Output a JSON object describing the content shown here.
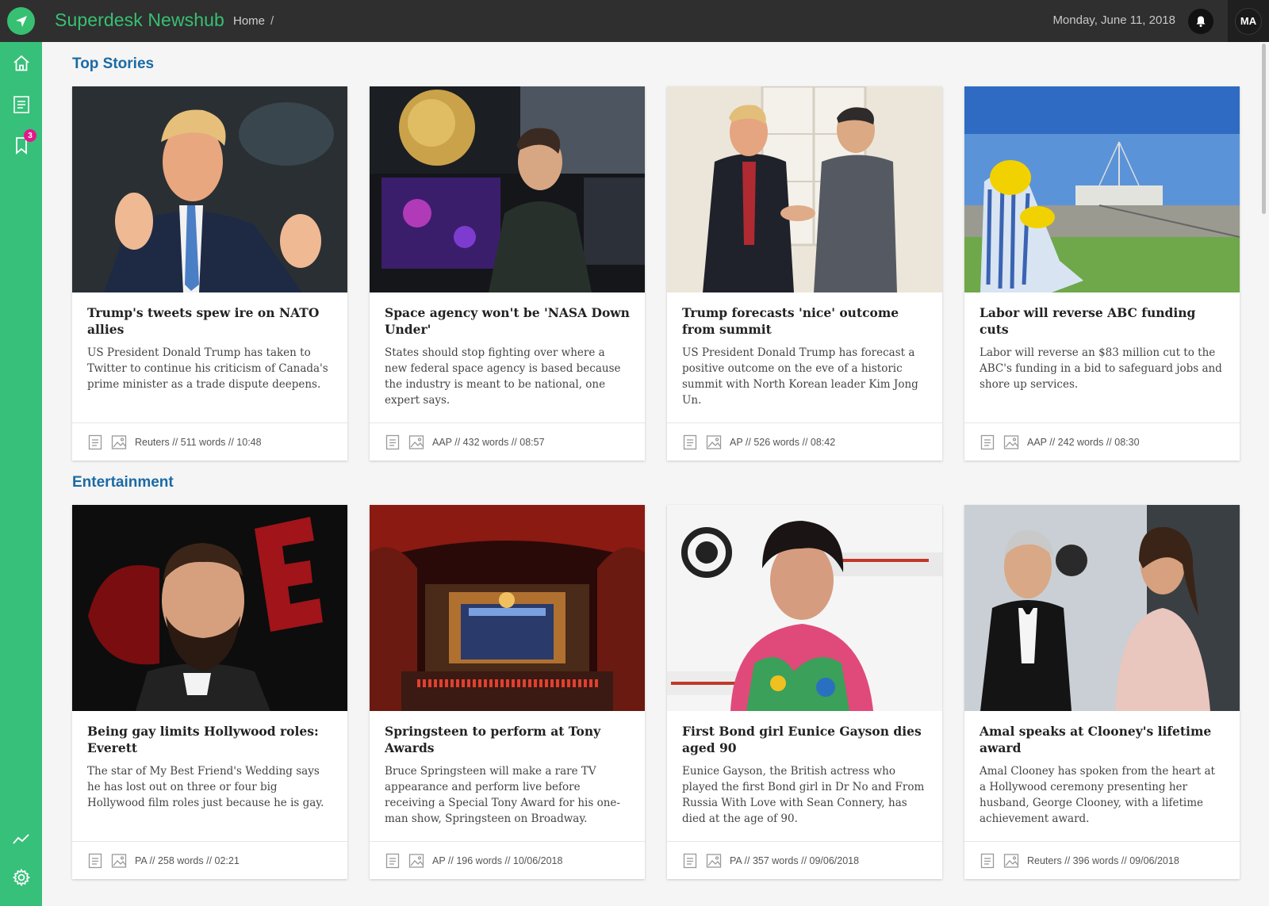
{
  "app": {
    "title": "Superdesk Newshub",
    "breadcrumb": "Home",
    "breadcrumb_sep": "/",
    "date": "Monday, June 11, 2018",
    "user_initials": "MA",
    "saved_count": "3"
  },
  "colors": {
    "brand": "#37c072",
    "sidebar": "#37c07a",
    "section_title": "#1b6aa5",
    "badge": "#e5178a"
  },
  "sections": [
    {
      "title": "Top Stories",
      "cards": [
        {
          "headline": "Trump's tweets spew ire on NATO allies",
          "summary": "US President Donald Trump has taken to Twitter to continue his criticism of Canada's prime minister as a trade dispute deepens.",
          "meta": "Reuters // 511 words // 10:48"
        },
        {
          "headline": "Space agency won't be 'NASA Down Under'",
          "summary": "States should stop fighting over where a new federal space agency is based because the industry is meant to be national, one expert says.",
          "meta": "AAP // 432 words // 08:57"
        },
        {
          "headline": "Trump forecasts 'nice' outcome from summit",
          "summary": "US President Donald Trump has forecast a positive outcome on the eve of a historic summit with North Korean leader Kim Jong Un.",
          "meta": "AP // 526 words // 08:42"
        },
        {
          "headline": "Labor will reverse ABC funding cuts",
          "summary": "Labor will reverse an $83 million cut to the ABC's funding in a bid to safeguard jobs and shore up services.",
          "meta": "AAP // 242 words // 08:30"
        }
      ]
    },
    {
      "title": "Entertainment",
      "cards": [
        {
          "headline": "Being gay limits Hollywood roles: Everett",
          "summary": "The star of My Best Friend's Wedding says he has lost out on three or four big Hollywood film roles just because he is gay.",
          "meta": "PA // 258 words // 02:21"
        },
        {
          "headline": "Springsteen to perform at Tony Awards",
          "summary": "Bruce Springsteen will make a rare TV appearance and perform live before receiving a Special Tony Award for his one-man show, Springsteen on Broadway.",
          "meta": "AP // 196 words // 10/06/2018"
        },
        {
          "headline": "First Bond girl Eunice Gayson dies aged 90",
          "summary": "Eunice Gayson, the British actress who played the first Bond girl in Dr No and From Russia With Love with Sean Connery, has died at the age of 90.",
          "meta": "PA // 357 words // 09/06/2018"
        },
        {
          "headline": "Amal speaks at Clooney's lifetime award",
          "summary": "Amal Clooney has spoken from the heart at a Hollywood ceremony presenting her husband, George Clooney, with a lifetime achievement award.",
          "meta": "Reuters // 396 words // 09/06/2018"
        }
      ]
    }
  ]
}
